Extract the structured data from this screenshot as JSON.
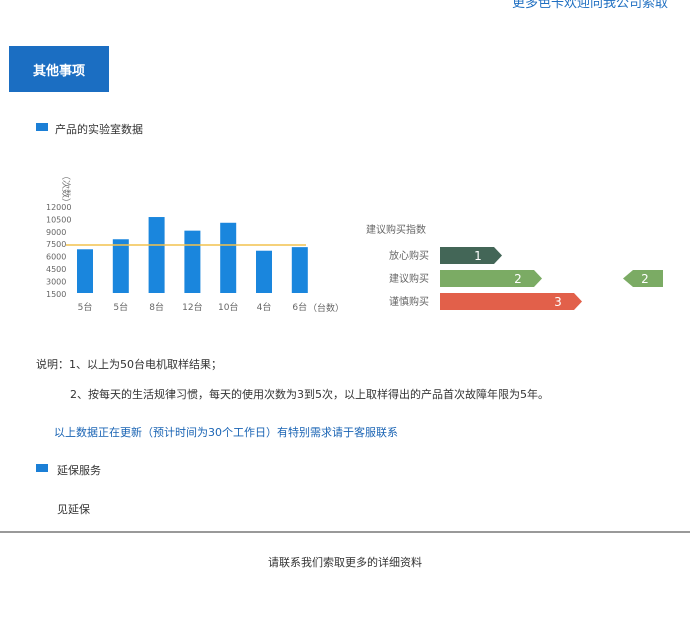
{
  "header": {
    "link_text": "更多色卡欢迎向我公司索取"
  },
  "section": {
    "tab_label": "其他事项"
  },
  "lab": {
    "heading": "产品的实验室数据"
  },
  "chart_data": [
    {
      "type": "bar",
      "ylabel": "（次数）",
      "xlabel": "（台数）",
      "yticks": [
        "12000",
        "10500",
        "9000",
        "7500",
        "6000",
        "4500",
        "3000",
        "1500"
      ],
      "categories": [
        "5台",
        "5台",
        "8台",
        "12台",
        "10台",
        "4台",
        "6台"
      ],
      "values": [
        6100,
        7500,
        10600,
        8700,
        9800,
        5900,
        6400
      ],
      "reference_line": 6700,
      "ylim": [
        0,
        12000
      ],
      "colors": {
        "bar": "#1a86dd",
        "line": "#f2c24f"
      }
    },
    {
      "type": "bar",
      "title": "建议购买指数",
      "categories": [
        "放心购买",
        "建议购买",
        "谨慎购买"
      ],
      "values": [
        1,
        2,
        3
      ],
      "labels": [
        "1",
        "2",
        "3"
      ],
      "colors": [
        "#436657",
        "#7bab64",
        "#e2604a"
      ],
      "side_marker": {
        "label": "2",
        "color": "#7bab64"
      }
    }
  ],
  "notes": {
    "line1": "说明：1、以上为50台电机取样结果；",
    "line2": "2、按每天的生活规律习惯，每天的使用次数为3到5次，以上取样得出的产品首次故障年限为5年。",
    "updating": "以上数据正在更新（预计时间为30个工作日）有特别需求请于客服联系"
  },
  "warranty": {
    "heading": "延保服务",
    "text": "见延保"
  },
  "footer": {
    "text": "请联系我们索取更多的详细资料"
  }
}
